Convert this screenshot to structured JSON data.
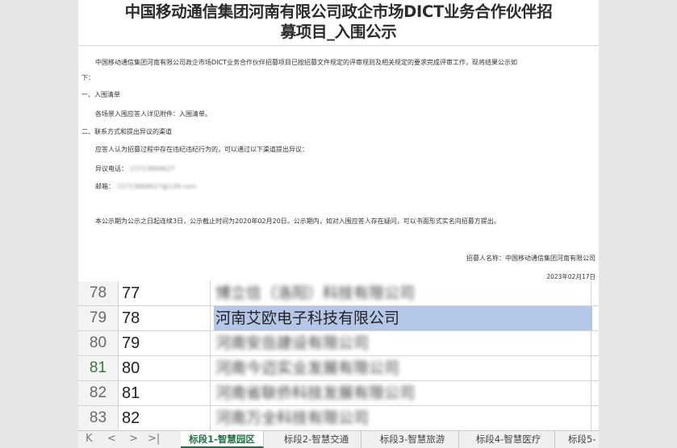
{
  "document": {
    "title_line1": "中国移动通信集团河南有限公司政企市场DICT业务合作伙伴招",
    "title_line2": "募项目_入围公示",
    "intro": "中国移动通信集团河南有限公司政企市场DICT业务合作伙伴招募项目已按招募文件规定的评审规则及相关规定的要求完成评审工作，现将结果公示如",
    "intro_cont": "下：",
    "section1_heading": "一、入围清单",
    "section1_body": "各场景入围应答人详见附件：入围清单。",
    "section2_heading": "二、联系方式和提出异议的渠道",
    "section2_body": "应答人认为招募过程中存在违纪违纪行为的，可以通过以下渠道提出异议：",
    "phone_label": "异议电话：",
    "phone_value": "15713869627",
    "email_label": "邮箱：",
    "email_value": "15713869627@139.com",
    "notice": "本公示期为公示之日起连续3日，公示截止时间为2020年02月20日。公示期内，如对入围应答人存在疑问，可以书面形式实名向招募方提出。",
    "signature": "招募人名称：中国移动通信集团河南有限公司",
    "date": "2023年02月17日"
  },
  "sheet": {
    "rows": [
      {
        "row_header": "78",
        "index": "77",
        "company": "博立信（洛阳）科技有限公司",
        "blurred": true,
        "selected": false,
        "active_row": false
      },
      {
        "row_header": "79",
        "index": "78",
        "company": "河南艾欧电子科技有限公司",
        "blurred": false,
        "selected": true,
        "active_row": false
      },
      {
        "row_header": "80",
        "index": "79",
        "company": "河南安岳建设有限公司",
        "blurred": true,
        "selected": false,
        "active_row": false
      },
      {
        "row_header": "81",
        "index": "80",
        "company": "河南今迈实业发展有限公司",
        "blurred": true,
        "selected": false,
        "active_row": true
      },
      {
        "row_header": "82",
        "index": "81",
        "company": "河南省联侨科技发展有限公司",
        "blurred": true,
        "selected": false,
        "active_row": false
      },
      {
        "row_header": "83",
        "index": "82",
        "company": "河南万全科技有限公司",
        "blurred": true,
        "selected": false,
        "active_row": false
      }
    ]
  },
  "tabs": {
    "nav": [
      "K",
      "<",
      ">",
      ">|"
    ],
    "items": [
      {
        "label": "标段1-智慧园区",
        "active": true
      },
      {
        "label": "标段2-智慧交通",
        "active": false
      },
      {
        "label": "标段3-智慧旅游",
        "active": false
      },
      {
        "label": "标段4-智慧医疗",
        "active": false
      },
      {
        "label": "标段5-",
        "active": false
      }
    ]
  },
  "colors": {
    "selection": "#b4c7e7",
    "active_tab_text": "#217346",
    "active_row_header": "#3a7a3a",
    "background": "#e6e6e6"
  }
}
